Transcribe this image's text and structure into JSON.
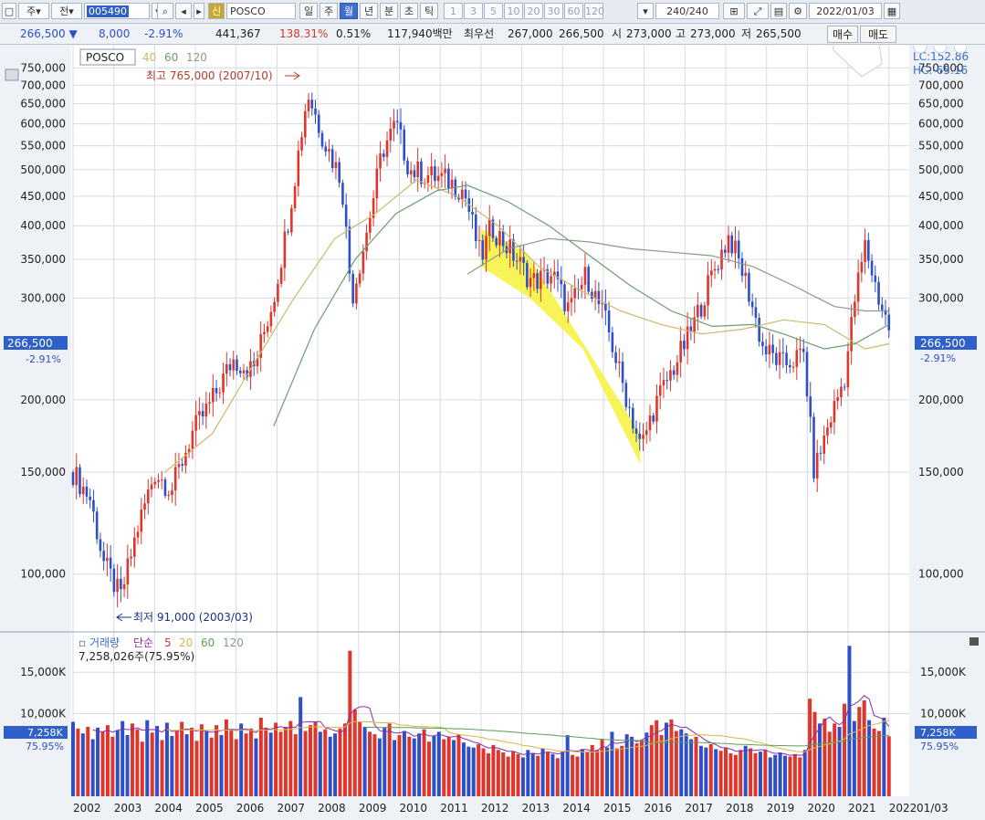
{
  "toolbar": {
    "market": "주",
    "period_sel": "전",
    "stock_code": "005490",
    "stock_name": "POSCO",
    "period_tabs": [
      "일",
      "주",
      "월",
      "년",
      "분",
      "초",
      "틱"
    ],
    "active_period": "월",
    "step_buttons": [
      "1",
      "3",
      "5",
      "10",
      "20",
      "30",
      "60",
      "120"
    ],
    "count_display": "240/240",
    "date": "2022/01/03"
  },
  "quote": {
    "price": "266,500",
    "change": "8,000",
    "change_pct": "-2.91%",
    "volume": "441,367",
    "volume_ratio": "138.31%",
    "turnover": "0.51%",
    "amount": "117,940백만",
    "best_ask_label": "최우선",
    "best_ask": "267,000",
    "best_bid": "266,500",
    "open_label": "시",
    "open": "273,000",
    "high_label": "고",
    "high": "273,000",
    "low_label": "저",
    "low": "265,500",
    "buy_btn": "매수",
    "sell_btn": "매도"
  },
  "colors": {
    "up": "#e0352b",
    "down": "#2f4fc8",
    "ma40": "#cdb86a",
    "ma60": "#6e9c6e",
    "ma120": "#8a9a8a",
    "highlight": "#f5f23a",
    "price_tag": "#2f5fc9"
  },
  "chart_data": [
    {
      "type": "candlestick",
      "title": "POSCO",
      "legend": [
        {
          "name": "40",
          "color": "#cdb86a"
        },
        {
          "name": "60",
          "color": "#6e9c6e"
        },
        {
          "name": "120",
          "color": "#8a9a8a"
        }
      ],
      "y_scale": "log",
      "ylim": [
        80000,
        790000
      ],
      "ytick_labels": [
        "750,000",
        "700,000",
        "650,000",
        "600,000",
        "550,000",
        "500,000",
        "450,000",
        "400,000",
        "350,000",
        "300,000",
        "200,000",
        "150,000",
        "100,000"
      ],
      "xtick_labels": [
        "2002",
        "2003",
        "2004",
        "2005",
        "2006",
        "2007",
        "2008",
        "2009",
        "2010",
        "2011",
        "2012",
        "2013",
        "2014",
        "2015",
        "2016",
        "2017",
        "2018",
        "2019",
        "2020",
        "2021",
        "2022",
        "01/03"
      ],
      "current_price_label": "266,500",
      "current_change_label": "-2.91%",
      "indicator_labels": [
        "LC:152.86",
        "HC:-65.16"
      ],
      "annotations": {
        "high": "최고 765,000 (2007/10)",
        "low": "최저 91,000 (2003/03)"
      },
      "price_path": [
        [
          "2002-01",
          150000
        ],
        [
          "2002-06",
          135000
        ],
        [
          "2002-10",
          105000
        ],
        [
          "2003-03",
          91000
        ],
        [
          "2003-08",
          120000
        ],
        [
          "2004-01",
          150000
        ],
        [
          "2004-06",
          140000
        ],
        [
          "2004-12",
          175000
        ],
        [
          "2005-06",
          200000
        ],
        [
          "2005-12",
          235000
        ],
        [
          "2006-06",
          225000
        ],
        [
          "2006-12",
          300000
        ],
        [
          "2007-04",
          400000
        ],
        [
          "2007-10",
          680000
        ],
        [
          "2008-03",
          560000
        ],
        [
          "2008-08",
          480000
        ],
        [
          "2008-11",
          300000
        ],
        [
          "2009-03",
          380000
        ],
        [
          "2009-08",
          540000
        ],
        [
          "2009-12",
          600000
        ],
        [
          "2010-04",
          500000
        ],
        [
          "2010-09",
          490000
        ],
        [
          "2011-03",
          480000
        ],
        [
          "2011-08",
          460000
        ],
        [
          "2012-01",
          350000
        ],
        [
          "2012-04",
          400000
        ],
        [
          "2012-10",
          360000
        ],
        [
          "2013-04",
          320000
        ],
        [
          "2013-10",
          330000
        ],
        [
          "2014-03",
          285000
        ],
        [
          "2014-08",
          330000
        ],
        [
          "2015-02",
          270000
        ],
        [
          "2015-06",
          220000
        ],
        [
          "2015-12",
          165000
        ],
        [
          "2016-04",
          195000
        ],
        [
          "2016-10",
          230000
        ],
        [
          "2017-03",
          265000
        ],
        [
          "2017-09",
          330000
        ],
        [
          "2018-02",
          385000
        ],
        [
          "2018-07",
          320000
        ],
        [
          "2018-12",
          245000
        ],
        [
          "2019-06",
          230000
        ],
        [
          "2019-12",
          240000
        ],
        [
          "2020-03",
          150000
        ],
        [
          "2020-07",
          180000
        ],
        [
          "2020-12",
          220000
        ],
        [
          "2021-03",
          300000
        ],
        [
          "2021-06",
          370000
        ],
        [
          "2021-10",
          300000
        ],
        [
          "2022-01",
          266500
        ]
      ],
      "ma40_path": [
        [
          "2004-04",
          150000
        ],
        [
          "2005-06",
          175000
        ],
        [
          "2006-06",
          230000
        ],
        [
          "2007-06",
          300000
        ],
        [
          "2008-06",
          380000
        ],
        [
          "2009-06",
          420000
        ],
        [
          "2010-06",
          480000
        ],
        [
          "2011-06",
          450000
        ],
        [
          "2012-06",
          400000
        ],
        [
          "2013-06",
          340000
        ],
        [
          "2014-06",
          310000
        ],
        [
          "2015-06",
          285000
        ],
        [
          "2016-06",
          270000
        ],
        [
          "2017-06",
          260000
        ],
        [
          "2018-06",
          265000
        ],
        [
          "2019-06",
          275000
        ],
        [
          "2020-06",
          270000
        ],
        [
          "2021-06",
          245000
        ],
        [
          "2022-01",
          250000
        ]
      ],
      "ma60_path": [
        [
          "2006-12",
          180000
        ],
        [
          "2007-12",
          265000
        ],
        [
          "2008-12",
          350000
        ],
        [
          "2009-12",
          420000
        ],
        [
          "2010-12",
          460000
        ],
        [
          "2011-09",
          470000
        ],
        [
          "2012-09",
          440000
        ],
        [
          "2013-09",
          400000
        ],
        [
          "2014-09",
          355000
        ],
        [
          "2015-09",
          315000
        ],
        [
          "2016-09",
          285000
        ],
        [
          "2017-09",
          268000
        ],
        [
          "2018-09",
          270000
        ],
        [
          "2019-06",
          260000
        ],
        [
          "2020-06",
          245000
        ],
        [
          "2021-03",
          250000
        ],
        [
          "2022-01",
          270000
        ]
      ],
      "ma120_path": [
        [
          "2011-09",
          330000
        ],
        [
          "2012-09",
          365000
        ],
        [
          "2013-09",
          380000
        ],
        [
          "2014-09",
          375000
        ],
        [
          "2015-09",
          365000
        ],
        [
          "2016-09",
          360000
        ],
        [
          "2017-09",
          355000
        ],
        [
          "2018-09",
          340000
        ],
        [
          "2019-09",
          315000
        ],
        [
          "2020-09",
          290000
        ],
        [
          "2021-06",
          285000
        ],
        [
          "2022-01",
          285000
        ]
      ]
    },
    {
      "type": "bar",
      "title": "거래량",
      "legend": [
        {
          "name": "거래량",
          "color": "#2f4fc8"
        },
        {
          "name": "단순",
          "color": "#8a2bb3"
        },
        {
          "name": "5",
          "color": "#c23b3b"
        },
        {
          "name": "20",
          "color": "#d7b64a"
        },
        {
          "name": "60",
          "color": "#5d9c5d"
        },
        {
          "name": "120",
          "color": "#8a9a8a"
        }
      ],
      "volume_readout": "7,258,026주(75.95%)",
      "ytick_labels": [
        "15,000K",
        "10,000K"
      ],
      "current_volume_label": "7,258K",
      "current_volume_pct": "75.95%",
      "ylim": [
        0,
        19000
      ],
      "volume_k": [
        9000,
        8200,
        7600,
        8400,
        6900,
        8300,
        7800,
        8600,
        7200,
        8000,
        9100,
        7400,
        8800,
        8100,
        6600,
        9200,
        7700,
        8500,
        6800,
        8900,
        7300,
        8000,
        9000,
        7500,
        8300,
        6700,
        8700,
        7900,
        7100,
        8600,
        7400,
        9300,
        8100,
        6900,
        8800,
        7600,
        8200,
        7000,
        9500,
        8300,
        7700,
        8900,
        7800,
        8400,
        9100,
        7500,
        12000,
        7900,
        8600,
        9000,
        7800,
        8100,
        7200,
        7600,
        8200,
        8800,
        17600,
        10500,
        9000,
        8400,
        7800,
        7500,
        7000,
        8300,
        8800,
        6800,
        7400,
        7900,
        7200,
        7000,
        7600,
        8100,
        6600,
        7300,
        7800,
        6900,
        7200,
        6800,
        7500,
        6500,
        6000,
        5900,
        6300,
        5800,
        5200,
        6200,
        5600,
        5300,
        4800,
        5400,
        5100,
        4700,
        5600,
        5200,
        4900,
        5800,
        5300,
        5100,
        4600,
        5400,
        7400,
        5000,
        4800,
        5700,
        5300,
        6200,
        5600,
        6900,
        5900,
        7800,
        5800,
        6100,
        7500,
        7200,
        6400,
        6800,
        7700,
        8600,
        9200,
        7400,
        8900,
        9300,
        7900,
        8100,
        7600,
        6900,
        7200,
        6100,
        5900,
        6300,
        5700,
        5500,
        5900,
        5200,
        5000,
        5600,
        6100,
        5800,
        5200,
        5400,
        5600,
        4700,
        5000,
        5300,
        4900,
        4800,
        5100,
        4700,
        5600,
        11800,
        10200,
        8800,
        9400,
        7800,
        8800,
        8400,
        11200,
        18200,
        9100,
        10800,
        11600,
        9200,
        8200,
        7900,
        9500,
        7258
      ]
    }
  ]
}
